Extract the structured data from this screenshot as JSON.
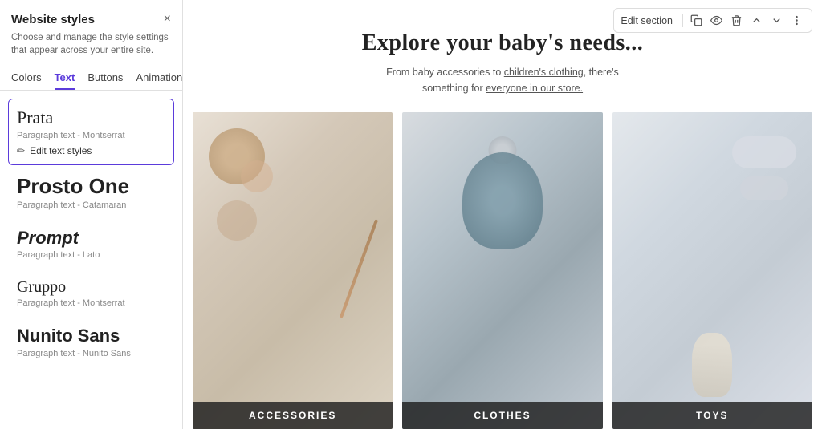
{
  "panel": {
    "title": "Website styles",
    "subtitle": "Choose and manage the style settings that appear across your entire site.",
    "close_label": "×",
    "tabs": [
      {
        "id": "colors",
        "label": "Colors"
      },
      {
        "id": "text",
        "label": "Text",
        "active": true
      },
      {
        "id": "buttons",
        "label": "Buttons"
      },
      {
        "id": "animations",
        "label": "Animations"
      }
    ],
    "fonts": [
      {
        "id": "prata",
        "name": "Prata",
        "paragraph": "Paragraph text - Montserrat",
        "selected": true,
        "edit_label": "Edit text styles"
      },
      {
        "id": "prosto-one",
        "name": "Prosto One",
        "paragraph": "Paragraph text - Catamaran",
        "selected": false
      },
      {
        "id": "prompt",
        "name": "Prompt",
        "paragraph": "Paragraph text - Lato",
        "selected": false
      },
      {
        "id": "gruppo",
        "name": "Gruppo",
        "paragraph": "Paragraph text - Montserrat",
        "selected": false
      },
      {
        "id": "nunito-sans",
        "name": "Nunito Sans",
        "paragraph": "Paragraph text - Nunito Sans",
        "selected": false
      }
    ]
  },
  "toolbar": {
    "edit_section_label": "Edit section",
    "icons": [
      "copy",
      "eye",
      "trash",
      "arrow-up",
      "arrow-down",
      "more"
    ]
  },
  "section": {
    "heading": "Explore your baby's needs...",
    "subtext": "From baby accessories to children's clothing, there's something for everyone in our store.",
    "products": [
      {
        "id": "accessories",
        "label": "ACCESSORIES"
      },
      {
        "id": "clothes",
        "label": "CLOTHES"
      },
      {
        "id": "toys",
        "label": "TOYS"
      }
    ]
  }
}
